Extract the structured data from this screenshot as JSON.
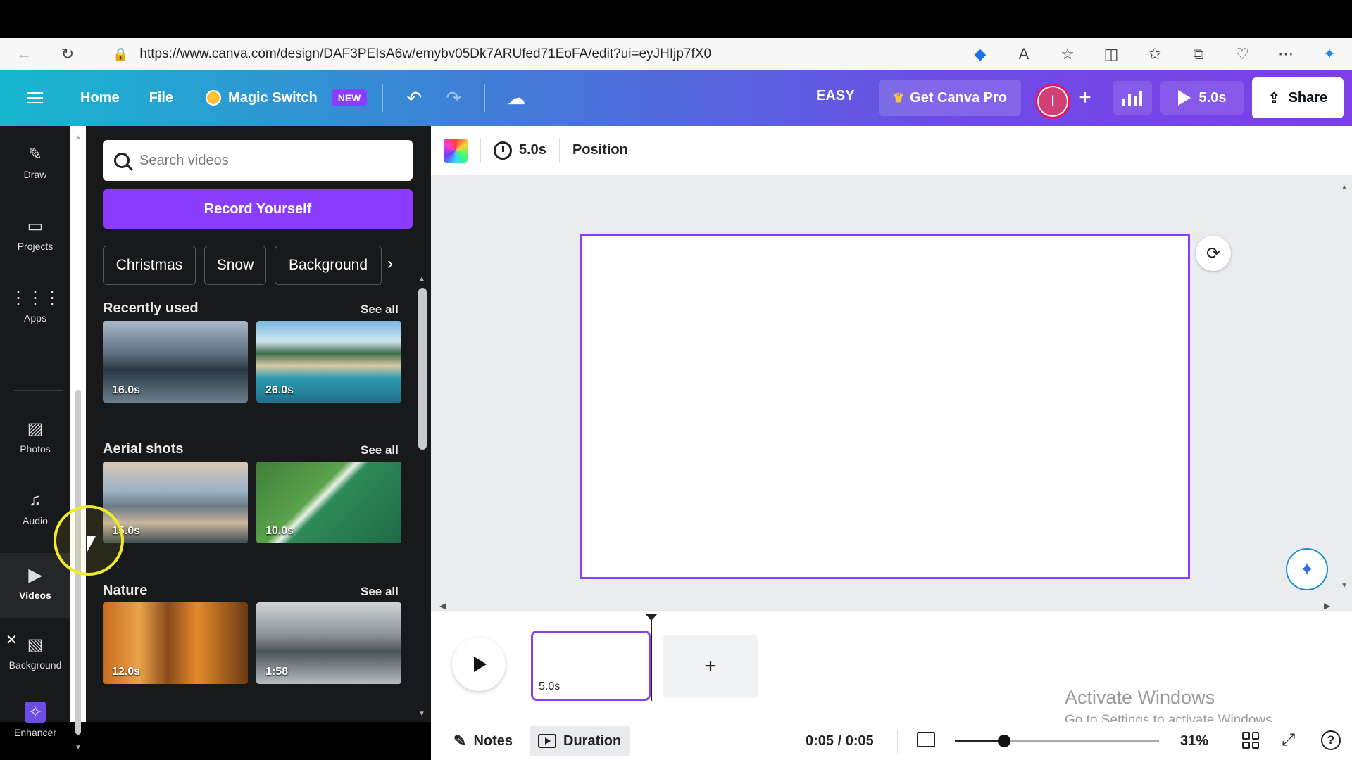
{
  "browser": {
    "url": "https://www.canva.com/design/DAF3PEIsA6w/emybv05Dk7ARUfed71EoFA/edit?ui=eyJHIjp7fX0"
  },
  "header": {
    "home": "Home",
    "file": "File",
    "magic_switch": "Magic Switch",
    "new_badge": "NEW",
    "design_title": "EASY",
    "get_pro": "Get Canva Pro",
    "avatar_initial": "I",
    "play_duration": "5.0s",
    "share": "Share"
  },
  "rail": {
    "items": [
      {
        "label": "Draw",
        "icon": "draw-icon"
      },
      {
        "label": "Projects",
        "icon": "folder-icon"
      },
      {
        "label": "Apps",
        "icon": "apps-grid-icon"
      },
      {
        "label": "Photos",
        "icon": "image-icon"
      },
      {
        "label": "Audio",
        "icon": "music-note-icon"
      },
      {
        "label": "Videos",
        "icon": "video-icon"
      },
      {
        "label": "Background",
        "icon": "background-pattern-icon"
      },
      {
        "label": "Enhancer",
        "icon": "enhancer-icon"
      }
    ],
    "active": "Videos"
  },
  "panel": {
    "search_placeholder": "Search videos",
    "record_button": "Record Yourself",
    "chips": [
      "Christmas",
      "Snow",
      "Background"
    ],
    "sections": [
      {
        "title": "Recently used",
        "see_all": "See all",
        "durations": [
          "16.0s",
          "26.0s"
        ]
      },
      {
        "title": "Aerial shots",
        "see_all": "See all",
        "durations": [
          "15.0s",
          "10.0s"
        ]
      },
      {
        "title": "Nature",
        "see_all": "See all",
        "durations": [
          "12.0s",
          "1:58"
        ]
      }
    ]
  },
  "toolbar": {
    "duration": "5.0s",
    "position": "Position"
  },
  "timeline": {
    "clip_duration": "5.0s",
    "activate_title": "Activate Windows",
    "activate_sub": "Go to Settings to activate Windows."
  },
  "footer": {
    "notes": "Notes",
    "duration": "Duration",
    "time": "0:05 / 0:05",
    "zoom_percent": "31%",
    "zoom_slider_fraction": 0.24
  },
  "colors": {
    "accent": "#8b3dff",
    "rail_bg": "#18191b",
    "canvas_bg": "#ebecf0"
  }
}
